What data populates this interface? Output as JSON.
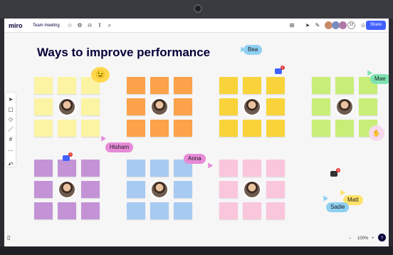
{
  "app": {
    "logo": "miro",
    "board_name": "Team meeting",
    "share_label": "Share",
    "collaborator_count": "12"
  },
  "board": {
    "title": "Ways to improve performance"
  },
  "zoom": {
    "level": "100%",
    "minus": "−",
    "plus": "+",
    "help": "?"
  },
  "cursors": [
    {
      "name": "Bea",
      "color": "#8fd0f2"
    },
    {
      "name": "Mae",
      "color": "#7ee3b0"
    },
    {
      "name": "Hisham",
      "color": "#e78bd8"
    },
    {
      "name": "Anna",
      "color": "#e78bd8"
    },
    {
      "name": "Matt",
      "color": "#ffe26a"
    },
    {
      "name": "Sadie",
      "color": "#8fd0f2"
    }
  ],
  "comment_badges": [
    "2",
    "3",
    "8"
  ],
  "colors": {
    "yellow": "#fcf4a3",
    "orange": "#fba24a",
    "gold": "#f9d33a",
    "green": "#c8ee78",
    "purple": "#c393d6",
    "blue": "#a7caf1",
    "pink": "#fac6dc",
    "brand": "#4262ff"
  },
  "icons": {
    "star": "star-icon",
    "settings": "gear-icon",
    "bell": "bell-icon",
    "upload": "upload-icon",
    "search": "search-icon",
    "cursor": "cursor-icon",
    "note": "sticky-note-icon",
    "shapes": "shapes-icon",
    "pen": "pen-icon",
    "frame": "frame-icon",
    "more": "more-icon",
    "undo": "undo-icon",
    "panel": "panel-icon"
  }
}
